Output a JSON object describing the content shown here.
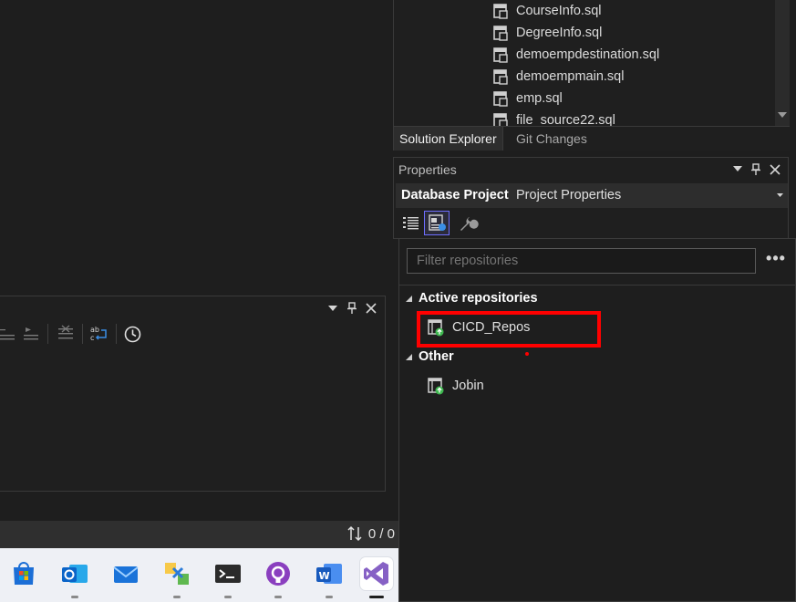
{
  "solution_explorer": {
    "files": [
      "CourseInfo.sql",
      "DegreeInfo.sql",
      "demoempdestination.sql",
      "demoempmain.sql",
      "emp.sql",
      "file_source22.sql"
    ],
    "tabs": [
      "Solution Explorer",
      "Git Changes"
    ]
  },
  "properties": {
    "title": "Properties",
    "selected_object": "Database Project",
    "selected_type": "Project Properties"
  },
  "repositories": {
    "filter_placeholder": "Filter repositories",
    "more_label": "•••",
    "active_header": "Active repositories",
    "active_items": [
      "CICD_Repos"
    ],
    "other_header": "Other",
    "other_items": [
      "Jobin"
    ]
  },
  "status_bar": {
    "counter": "0 / 0"
  },
  "taskbar": {
    "apps": [
      "microsoft-store-icon",
      "outlook-icon",
      "mail-icon",
      "power-automate-icon",
      "terminal-icon",
      "github-desktop-icon",
      "word-icon",
      "visual-studio-icon"
    ]
  },
  "colors": {
    "highlight": "#ff0000",
    "panel_bg": "#1f1f1f",
    "taskbar_bg": "#eef0f5"
  }
}
